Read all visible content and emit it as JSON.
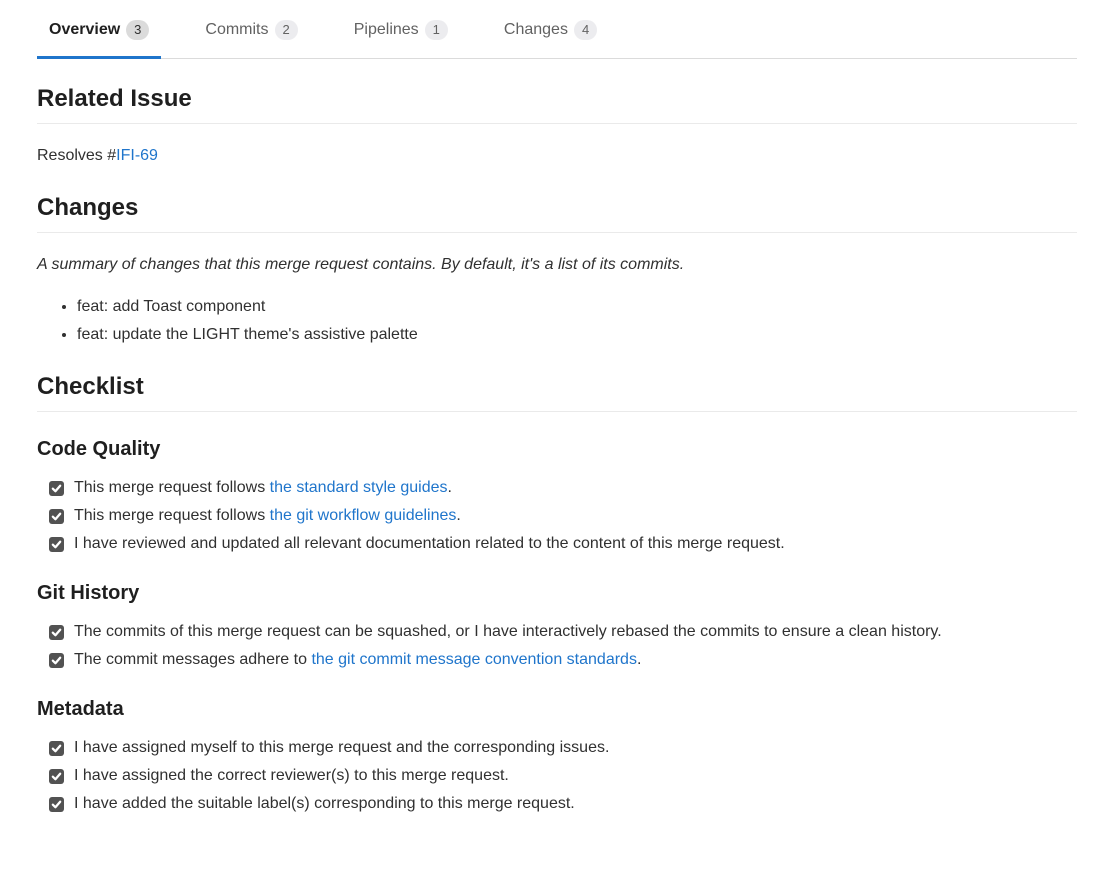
{
  "tabs": [
    {
      "label": "Overview",
      "count": "3",
      "active": true
    },
    {
      "label": "Commits",
      "count": "2",
      "active": false
    },
    {
      "label": "Pipelines",
      "count": "1",
      "active": false
    },
    {
      "label": "Changes",
      "count": "4",
      "active": false
    }
  ],
  "sections": {
    "related_issue": {
      "heading": "Related Issue",
      "prefix": "Resolves #",
      "link_text": "IFI-69"
    },
    "changes": {
      "heading": "Changes",
      "summary": "A summary of changes that this merge request contains. By default, it's a list of its commits.",
      "commits": [
        "feat: add Toast component",
        "feat: update the LIGHT theme's assistive palette"
      ]
    },
    "checklist": {
      "heading": "Checklist",
      "groups": [
        {
          "heading": "Code Quality",
          "items": [
            {
              "checked": true,
              "parts": [
                {
                  "type": "text",
                  "value": "This merge request follows "
                },
                {
                  "type": "link",
                  "value": "the standard style guides"
                },
                {
                  "type": "text",
                  "value": "."
                }
              ]
            },
            {
              "checked": true,
              "parts": [
                {
                  "type": "text",
                  "value": "This merge request follows "
                },
                {
                  "type": "link",
                  "value": "the git workflow guidelines"
                },
                {
                  "type": "text",
                  "value": "."
                }
              ]
            },
            {
              "checked": true,
              "parts": [
                {
                  "type": "text",
                  "value": "I have reviewed and updated all relevant documentation related to the content of this merge request."
                }
              ]
            }
          ]
        },
        {
          "heading": "Git History",
          "items": [
            {
              "checked": true,
              "parts": [
                {
                  "type": "text",
                  "value": "The commits of this merge request can be squashed, or I have interactively rebased the commits to ensure a clean history."
                }
              ]
            },
            {
              "checked": true,
              "parts": [
                {
                  "type": "text",
                  "value": "The commit messages adhere to "
                },
                {
                  "type": "link",
                  "value": "the git commit message convention standards"
                },
                {
                  "type": "text",
                  "value": "."
                }
              ]
            }
          ]
        },
        {
          "heading": "Metadata",
          "items": [
            {
              "checked": true,
              "parts": [
                {
                  "type": "text",
                  "value": "I have assigned myself to this merge request and the corresponding issues."
                }
              ]
            },
            {
              "checked": true,
              "parts": [
                {
                  "type": "text",
                  "value": "I have assigned the correct reviewer(s) to this merge request."
                }
              ]
            },
            {
              "checked": true,
              "parts": [
                {
                  "type": "text",
                  "value": "I have added the suitable label(s) corresponding to this merge request."
                }
              ]
            }
          ]
        }
      ]
    }
  }
}
